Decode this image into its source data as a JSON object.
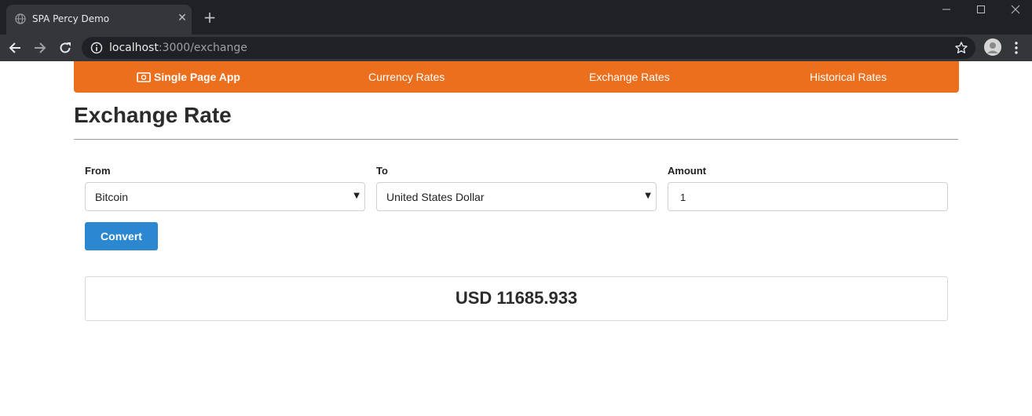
{
  "browser": {
    "tab_title": "SPA Percy Demo",
    "tab_close": "✕",
    "new_tab": "+",
    "url_host": "localhost",
    "url_path": ":3000/exchange",
    "icons": {
      "favicon": "globe-icon",
      "back": "back-arrow-icon",
      "forward": "forward-arrow-icon",
      "reload": "reload-icon",
      "info": "info-icon",
      "star": "star-icon",
      "avatar": "avatar-icon",
      "menu": "kebab-menu-icon"
    }
  },
  "navbar": {
    "brand": "Single Page App",
    "brand_icon": "money-bill-icon",
    "links": [
      "Currency Rates",
      "Exchange Rates",
      "Historical Rates"
    ],
    "color": "#ec6f1e"
  },
  "page": {
    "title": "Exchange Rate"
  },
  "form": {
    "from_label": "From",
    "from_value": "Bitcoin",
    "to_label": "To",
    "to_value": "United States Dollar",
    "amount_label": "Amount",
    "amount_value": "1",
    "convert_label": "Convert",
    "convert_color": "#2a87d0"
  },
  "result": {
    "text": "USD 11685.933"
  }
}
